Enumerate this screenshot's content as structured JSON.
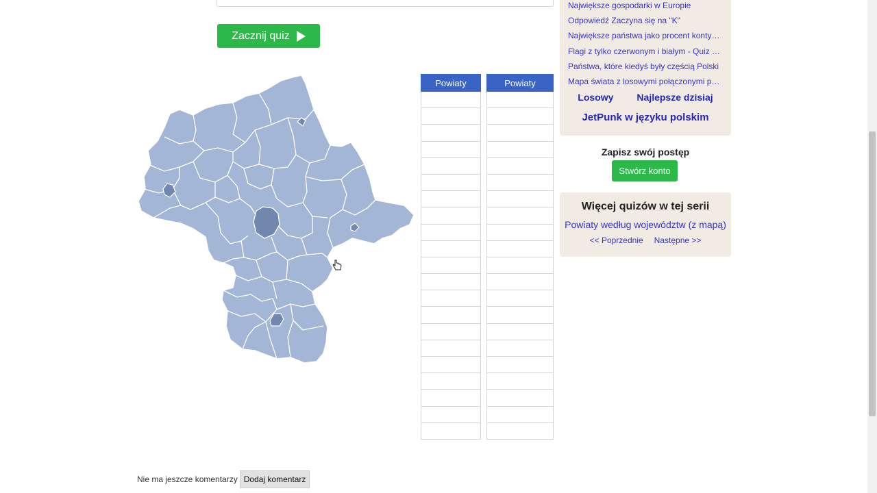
{
  "quiz": {
    "answer_input_placeholder": "",
    "start_button_label": "Zacznij quiz",
    "map_region": "mazowieckie-powiaty",
    "table_header_1": "Powiaty",
    "table_header_2": "Powiaty",
    "table_rows_per_column": 21
  },
  "sidebar": {
    "links": [
      "Największe gospodarki w Europie",
      "Odpowiedź Zaczyna się na \"K\"",
      "Największe państwa jako procent kontynentu",
      "Flagi z tylko czerwonym i białym - Quiz o flagach",
      "Państwa, które kiedyś były częścią Polski",
      "Mapa świata z losowymi połączonymi państwami"
    ],
    "random_label": "Losowy",
    "best_today_label": "Najlepsze dzisiaj",
    "jetpunk_polish_label": "JetPunk w języku polskim"
  },
  "account": {
    "save_progress_label": "Zapisz swój postęp",
    "create_account_label": "Stwórz konto"
  },
  "series": {
    "heading": "Więcej quizów w tej serii",
    "series_link": "Powiaty według województw (z mapą)",
    "prev_label": "<< Poprzednie",
    "next_label": "Następne >>"
  },
  "comments": {
    "no_comments_text": "Nie ma jeszcze komentarzy",
    "add_comment_label": "Dodaj komentarz"
  },
  "colors": {
    "map_fill": "#a3b6d6",
    "map_fill_dark": "#7187ad",
    "table_header": "#3a63c6",
    "green_button": "#2db84a",
    "sidebar_bg": "#f1ebe3",
    "link": "#3535c9"
  },
  "icons": {
    "play": "play-icon",
    "cursor": "hand-pointer-icon"
  }
}
